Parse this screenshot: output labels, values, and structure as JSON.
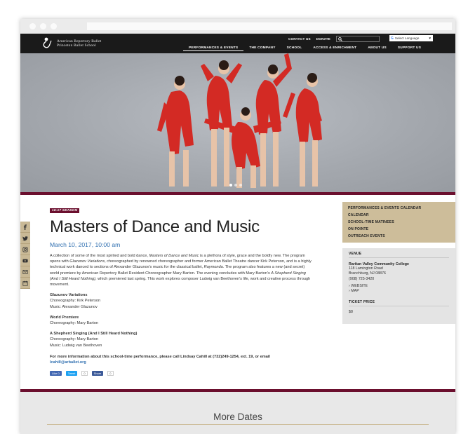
{
  "header": {
    "logo_line1": "American Repertory Ballet",
    "logo_line2": "Princeton Ballet School",
    "utility_links": [
      "CONTACT US",
      "DONATE"
    ],
    "language_label": "Select Language",
    "nav": [
      "PERFORMANCES & EVENTS",
      "THE COMPANY",
      "SCHOOL",
      "ACCESS & ENRICHMENT",
      "ABOUT US",
      "SUPPORT US"
    ]
  },
  "social": [
    "facebook-icon",
    "twitter-icon",
    "instagram-icon",
    "youtube-icon",
    "mail-icon",
    "calendar-icon"
  ],
  "event": {
    "tag": "16-17 SEASON",
    "title": "Masters of Dance and Music",
    "date": "March 10, 2017, 10:00 am",
    "description": "A collection of some of the most spirited and bold dance, Masters of Dance and Music is a plethora of style, grace and the boldly new. The program opens with Glazunov Variations, choreographed by renowned choreographer and former American Ballet Theatre dancer Kirk Peterson, and is a highly technical work danced to sections of Alexander Glazunov's music for the classical ballet, Raymonda. The program also features a new (and secret) world premiere by American Repertory Ballet Resident Choreographer Mary Barton. The evening concludes with Mary Barton's A Shepherd Singing (And I Still Heard Nothing), which premiered last spring. This work explores composer Ludwig van Beethoven's life, work and creative process through movement.",
    "pieces": [
      {
        "title": "Glazunov Variations",
        "lines": [
          "Choreography: Kirk Peterson",
          "Music: Alexander Glazunov"
        ]
      },
      {
        "title": "World Premiere",
        "lines": [
          "Choreography: Mary Barton"
        ]
      },
      {
        "title": "A Shepherd Singing (And I Still Heard Nothing)",
        "lines": [
          "Choreography: Mary Barton",
          "Music: Ludwig van Beethoven"
        ]
      }
    ],
    "contact_text": "For more information about this school-time performance, please call Lindsay Cahill at (732)249-1254, ext. 19, or email",
    "contact_email": "lcahill@arballet.org",
    "share": {
      "like": "Like 0",
      "tweet": "Tweet",
      "tweet_count": "0",
      "fb_share": "Share",
      "fb_share_count": "0"
    }
  },
  "sidebar": {
    "links": [
      "PERFORMANCES & EVENTS CALENDAR",
      "CALENDAR",
      "SCHOOL-TIME MATINEES",
      "ON POINTE",
      "OUTREACH EVENTS"
    ],
    "venue_heading": "VENUE",
    "venue_name": "Raritan Valley Community College",
    "venue_address": [
      "118 Lamington Road",
      "Branchburg, NJ 08876",
      "(908) 725-3420"
    ],
    "venue_links": [
      "WEBSITE",
      "MAP"
    ],
    "price_heading": "TICKET PRICE",
    "price": "$8"
  },
  "more_dates": "More Dates",
  "colors": {
    "maroon": "#6b0f2e",
    "tan": "#cdbd9a",
    "link_blue": "#2f6fb0",
    "header_black": "#1a1a1a"
  }
}
